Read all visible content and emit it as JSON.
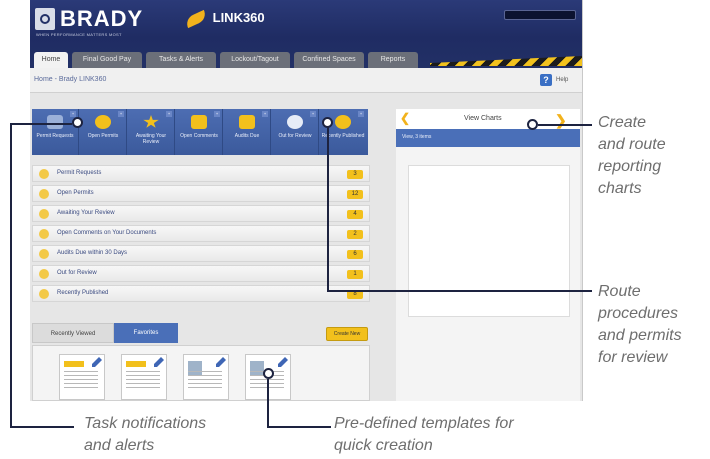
{
  "header": {
    "brand": "BRADY",
    "brand_tag": "WHEN PERFORMANCE MATTERS MOST",
    "product": "LINK360"
  },
  "nav": {
    "tabs": [
      {
        "label": "Home",
        "active": true
      },
      {
        "label": "Final Good Pay",
        "active": false
      },
      {
        "label": "Tasks & Alerts",
        "active": false
      },
      {
        "label": "Lockout/Tagout",
        "active": false
      },
      {
        "label": "Confined Spaces",
        "active": false
      },
      {
        "label": "Reports",
        "active": false
      }
    ]
  },
  "breadcrumb": "Home - Brady LINK360",
  "help_label": "Help",
  "quick_buttons": [
    {
      "label": "Permit Requests",
      "icon": "people-icon",
      "color": "#9bb0d9"
    },
    {
      "label": "Open Permits",
      "icon": "clipboard-icon",
      "color": "#f2c01c"
    },
    {
      "label": "Awaiting Your Review",
      "icon": "star-icon",
      "color": "#f2c01c"
    },
    {
      "label": "Open Comments",
      "icon": "comment-icon",
      "color": "#f2c01c"
    },
    {
      "label": "Audits Due",
      "icon": "calendar-icon",
      "color": "#f2c01c"
    },
    {
      "label": "Out for Review",
      "icon": "share-icon",
      "color": "#e6ecf7"
    },
    {
      "label": "Recently Published",
      "icon": "published-icon",
      "color": "#f2c01c"
    }
  ],
  "tasks": [
    {
      "label": "Permit Requests",
      "count": "3"
    },
    {
      "label": "Open Permits",
      "count": "12"
    },
    {
      "label": "Awaiting Your Review",
      "count": "4"
    },
    {
      "label": "Open Comments on Your Documents",
      "count": "2"
    },
    {
      "label": "Audits Due within 30 Days",
      "count": "6"
    },
    {
      "label": "Out for Review",
      "count": "1"
    },
    {
      "label": "Recently Published",
      "count": "8"
    }
  ],
  "lower_tabs": {
    "recent": "Recently Viewed",
    "favorites": "Favorites"
  },
  "create_new_label": "Create New",
  "right_panel": {
    "title": "View Charts",
    "subtitle": "View, 3 items"
  },
  "callouts": {
    "charts": [
      "Create",
      "and route",
      "reporting",
      "charts"
    ],
    "routing": [
      "Route",
      "procedures",
      "and permits",
      "for review"
    ],
    "tasks": [
      "Task notifications",
      "and alerts"
    ],
    "templates": [
      "Pre-defined templates for",
      "quick creation"
    ]
  },
  "colors": {
    "accent": "#f2c01c",
    "navy": "#223066",
    "blue": "#4a6fb8"
  }
}
